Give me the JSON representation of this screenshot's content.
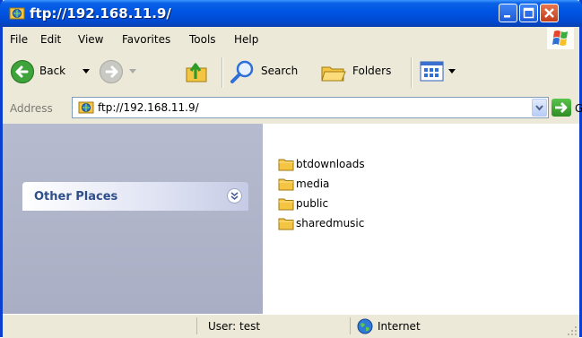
{
  "window": {
    "title": "ftp://192.168.11.9/"
  },
  "menu": [
    "File",
    "Edit",
    "View",
    "Favorites",
    "Tools",
    "Help"
  ],
  "toolbar": {
    "back_label": "Back",
    "search_label": "Search",
    "folders_label": "Folders"
  },
  "address": {
    "label": "Address",
    "value": "ftp://192.168.11.9/",
    "go_label": "Go"
  },
  "left_pane": {
    "section_title": "Other Places"
  },
  "files": [
    "btdownloads",
    "media",
    "public",
    "sharedmusic"
  ],
  "status": {
    "user": "User: test",
    "zone": "Internet"
  },
  "colors": {
    "titlebar": "#0054e3",
    "folder": "#f4c542",
    "go": "#2f8d25"
  }
}
